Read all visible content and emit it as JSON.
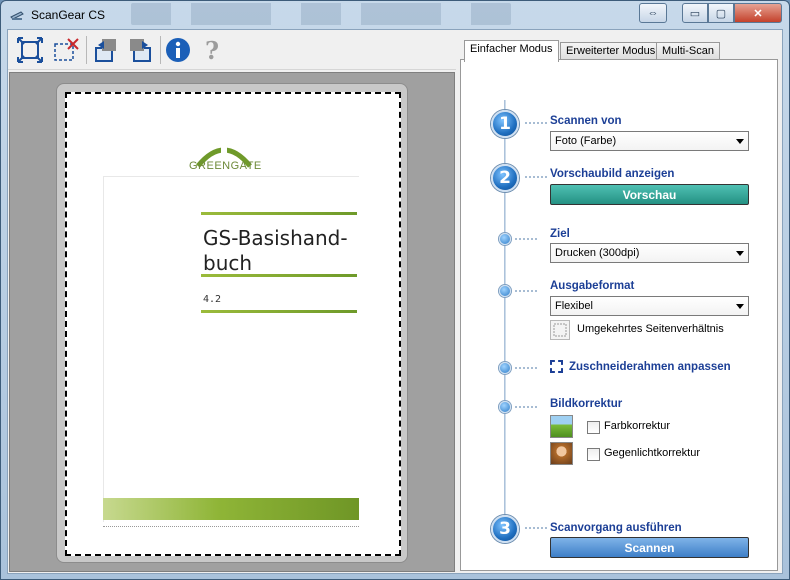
{
  "window": {
    "title": "ScanGear CS",
    "swap_label": "⇔",
    "min_label": "▭",
    "max_label": "▢",
    "close_label": "✕"
  },
  "toolbar": {
    "icons": [
      "crop-auto-icon",
      "crop-clear-icon",
      "rotate-left-icon",
      "rotate-right-icon",
      "info-icon",
      "help-icon"
    ]
  },
  "preview": {
    "logo_text": "GREENGATE",
    "doc_title": "GS-Basishand-buch",
    "doc_title_line1": "GS-Basishand-",
    "doc_title_line2": "buch",
    "doc_version": "4.2"
  },
  "tabs": [
    {
      "label": "Einfacher Modus",
      "active": true
    },
    {
      "label": "Erweiterter Modus",
      "active": false
    },
    {
      "label": "Multi-Scan",
      "active": false
    }
  ],
  "steps": {
    "step1": {
      "number": "1",
      "label": "Scannen von",
      "value": "Foto (Farbe)"
    },
    "step2": {
      "number": "2",
      "label": "Vorschaubild anzeigen",
      "button": "Vorschau"
    },
    "ziel": {
      "label": "Ziel",
      "value": "Drucken (300dpi)"
    },
    "ausgabe": {
      "label": "Ausgabeformat",
      "value": "Flexibel",
      "invert_label": "Umgekehrtes Seitenverhältnis"
    },
    "crop": {
      "label": "Zuschneiderahmen anpassen"
    },
    "bild": {
      "label": "Bildkorrektur",
      "farb": "Farbkorrektur",
      "gegen": "Gegenlichtkorrektur"
    },
    "step3": {
      "number": "3",
      "label": "Scanvorgang ausführen",
      "button": "Scannen"
    }
  },
  "colors": {
    "accent_blue": "#1c3f96",
    "preview_teal": "#249183",
    "scan_blue": "#3e7fc8",
    "doc_green": "#8fb537"
  }
}
